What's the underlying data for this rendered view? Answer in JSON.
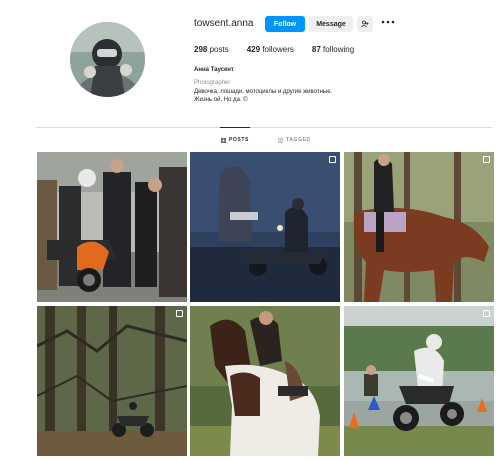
{
  "profile": {
    "username": "towsent.anna",
    "follow_label": "Follow",
    "message_label": "Message",
    "suggest_icon": "add-person-icon",
    "more_icon": "more-options-icon",
    "posts_count": "298",
    "posts_label": "posts",
    "followers_count": "429",
    "followers_label": "followers",
    "following_count": "87",
    "following_label": "following",
    "full_name": "Анна Таусент",
    "category": "Photographer",
    "bio_line1": "Девочка, лошади, мотоциклы и другие животные.",
    "bio_line2": "Жизнь ой. Но да. ©"
  },
  "tabs": [
    {
      "label": "POSTS",
      "icon": "grid-icon",
      "active": true
    },
    {
      "label": "TAGGED",
      "icon": "tag-icon",
      "active": false
    }
  ],
  "colors": {
    "accent": "#0095f6",
    "text": "#262626",
    "muted": "#8e8e8e",
    "divider": "#dbdbdb"
  },
  "posts": [
    {
      "subject": "group of motorcyclists with orange motorcycle",
      "multi": false
    },
    {
      "subject": "motorcycle riders at dusk",
      "multi": true
    },
    {
      "subject": "rider on brown horse in forest",
      "multi": true
    },
    {
      "subject": "motorcycle among pine trees",
      "multi": true
    },
    {
      "subject": "girl hugging brown and white horse",
      "multi": false
    },
    {
      "subject": "motocross rider on track with cones",
      "multi": true
    }
  ]
}
